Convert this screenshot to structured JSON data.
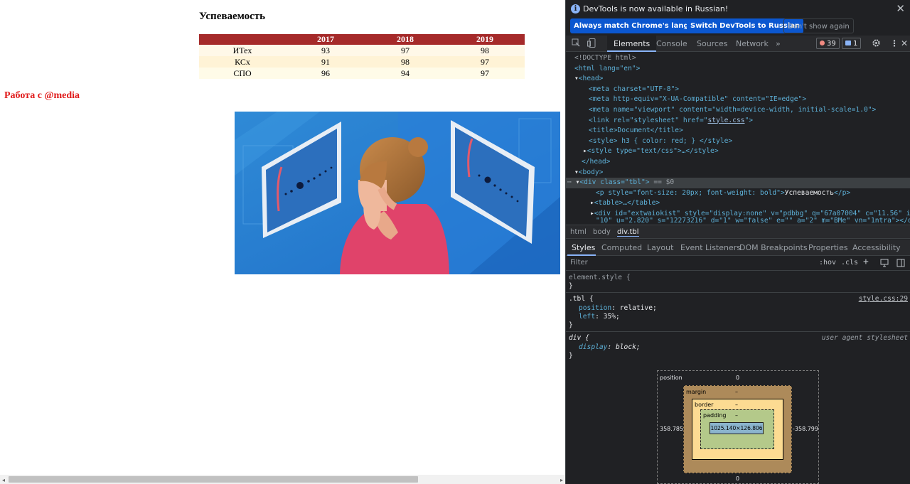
{
  "page": {
    "title": "Успеваемость",
    "table": {
      "headers": [
        "",
        "2017",
        "2018",
        "2019"
      ],
      "rows": [
        [
          "ИТех",
          "93",
          "97",
          "98"
        ],
        [
          "КСх",
          "91",
          "98",
          "97"
        ],
        [
          "СПО",
          "96",
          "94",
          "97"
        ]
      ]
    },
    "media_heading": "Работа с @media",
    "scroll_left": "◂",
    "scroll_right": "▸"
  },
  "devtools": {
    "info_icon": "i",
    "info_message": "DevTools is now available in Russian!",
    "btn_match": "Always match Chrome's language",
    "btn_switch": "Switch DevTools to Russian",
    "btn_dont_show": "Don't show again",
    "close": "✕",
    "tabs": [
      "Elements",
      "Console",
      "Sources",
      "Network"
    ],
    "more_tabs": "»",
    "errors_count": "39",
    "messages_count": "1",
    "dom": {
      "doctype": "<!DOCTYPE html>",
      "html_open": "<html lang=\"en\">",
      "head_open": "<head>",
      "meta_charset": "<meta charset=\"UTF-8\">",
      "meta_http": "<meta http-equiv=\"X-UA-Compatible\" content=\"IE=edge\">",
      "meta_viewport": "<meta name=\"viewport\" content=\"width=device-width, initial-scale=1.0\">",
      "link_pre": "<link rel=\"stylesheet\" href=\"",
      "link_href": "style.css",
      "link_post": "\">",
      "title_line": "<title>Document</title>",
      "style_line": "<style> h3 { color: red; } </style>",
      "style_css": "<style type=\"text/css\">…</style>",
      "head_close": "</head>",
      "body_open": "<body>",
      "div_tbl": "<div class=\"tbl\">",
      "div_eq": " == $0",
      "p_line_open": "<p style=\"font-size: 20px; font-weight: bold\">",
      "p_text": "Успеваемость",
      "p_close": "</p>",
      "table_line": "<table>…</table>",
      "ext_line": "<div id=\"extwaiokist\" style=\"display:none\" v=\"pdbbg\" q=\"67a07004\" c=\"11.56\" i=",
      "ext_line2": "\"10\" u=\"2.820\" s=\"12273216\" d=\"1\" w=\"false\" e=\"\" a=\"2\" m=\"BMe\" vn=\"1ntra\"></div>"
    },
    "breadcrumbs": [
      "html",
      "body",
      "div.tbl"
    ],
    "subtabs": [
      "Styles",
      "Computed",
      "Layout",
      "Event Listeners",
      "DOM Breakpoints",
      "Properties",
      "Accessibility"
    ],
    "filter_placeholder": "Filter",
    "filter_hov": ":hov",
    "filter_cls": ".cls",
    "filter_plus": "+",
    "styles": {
      "element_style": "element.style {",
      "close_brace": "}",
      "tbl_selector": ".tbl {",
      "tbl_source": "style.css:29",
      "prop_position": "position",
      "val_position": "relative;",
      "prop_left": "left",
      "val_left": "35%;",
      "div_selector": "div {",
      "div_source": "user agent stylesheet",
      "prop_display": "display",
      "val_display": "block;"
    },
    "box_model": {
      "position_label": "position",
      "position_top": "0",
      "position_bottom": "0",
      "position_left": "358.785",
      "position_right": "-358.799",
      "margin_label": "margin",
      "margin_value": "–",
      "border_label": "border",
      "border_value": "–",
      "padding_label": "padding",
      "padding_value": "–",
      "content_size": "1025.140×126.806"
    }
  }
}
